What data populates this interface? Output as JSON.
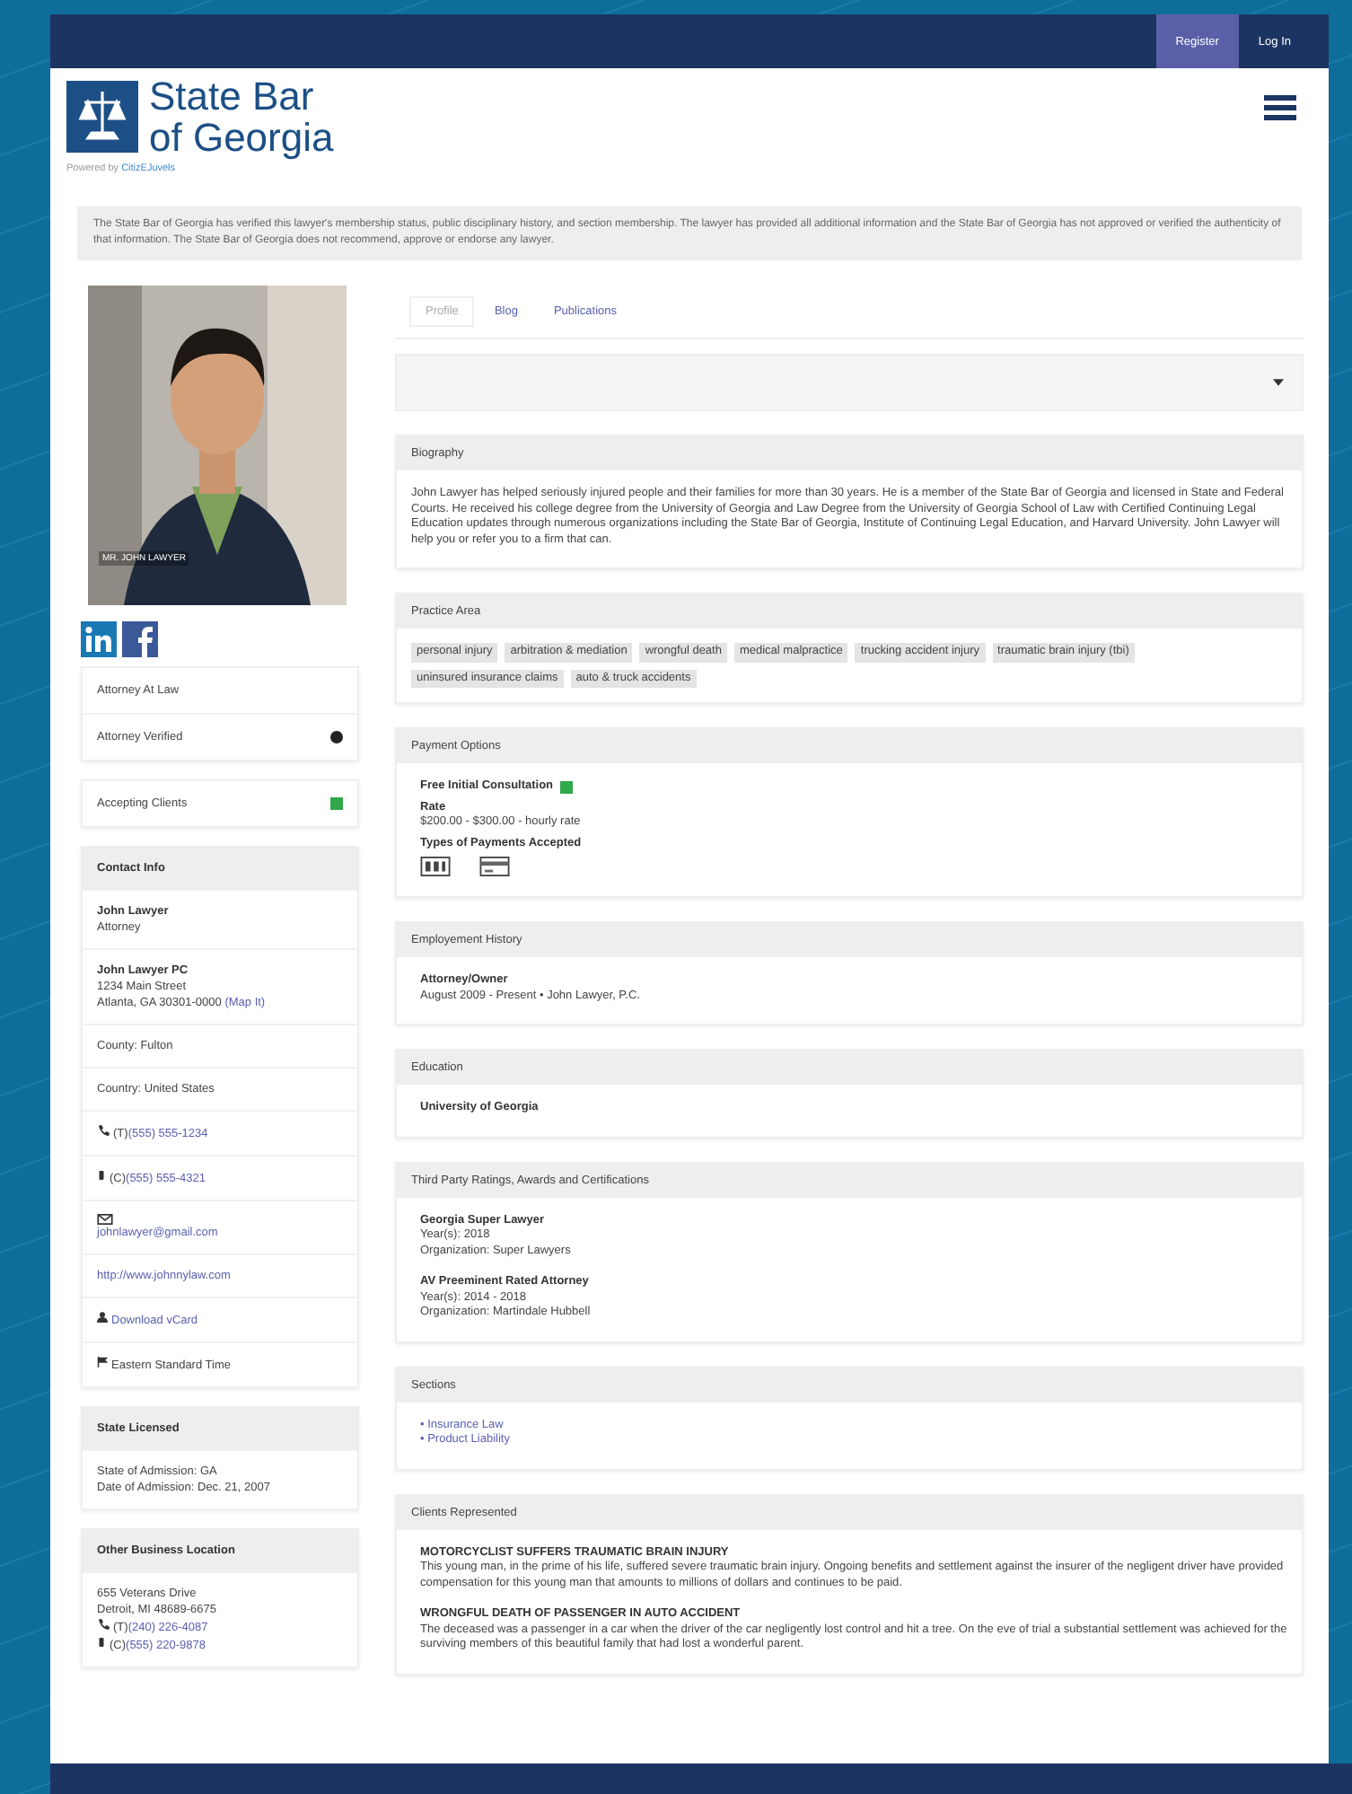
{
  "top_bar": {
    "buttons": [
      {
        "label": "Register",
        "selected": true
      },
      {
        "label": "Log In",
        "selected": false
      }
    ]
  },
  "logo": {
    "line1": "State Bar",
    "line2": "of Georgia",
    "powered_prefix": "Powered by",
    "powered_brand": "CitizEJuvels"
  },
  "notice": "The State Bar of Georgia has verified this lawyer's membership status, public disciplinary history, and section membership. The lawyer has provided all additional information and the State Bar of Georgia has not approved or verified the authenticity of that information. The State Bar of Georgia does not recommend, approve or endorse any lawyer.",
  "profile": {
    "photo_caption": "MR. JOHN LAWYER",
    "social": [
      {
        "kind": "linkedin"
      },
      {
        "kind": "facebook"
      }
    ]
  },
  "status_items": [
    {
      "label": "Attorney At Law",
      "kind": "plain"
    },
    {
      "label": "Attorney Verified",
      "kind": "verified"
    }
  ],
  "accepting_clients": {
    "label": "Accepting Clients",
    "checked": true
  },
  "contact_info": {
    "title": "Contact Info",
    "name": "John Lawyer",
    "role": "Attorney",
    "firm": "John Lawyer PC",
    "street": "1234 Main Street",
    "city": "Atlanta, GA 30301-0000",
    "map_link": "(Map It)",
    "rows": [
      {
        "kind": "text",
        "text": "County: Fulton"
      },
      {
        "kind": "text",
        "text": "Country: United States"
      },
      {
        "kind": "phone",
        "prefix": "(T)",
        "text": "(555) 555-1234"
      },
      {
        "kind": "mobile",
        "prefix": "(C)",
        "text": "(555) 555-4321"
      },
      {
        "kind": "email",
        "text": "johnlawyer@gmail.com"
      },
      {
        "kind": "link",
        "text": "http://www.johnnylaw.com"
      },
      {
        "kind": "vcard",
        "text": "Download vCard"
      },
      {
        "kind": "timezone",
        "text": "Eastern Standard Time"
      }
    ]
  },
  "state_licensed": {
    "title": "State Licensed",
    "lines": [
      "State of Admission: GA",
      "Date of Admission: Dec. 21, 2007"
    ]
  },
  "other_location": {
    "title": "Other Business Location",
    "lines": [
      "655 Veterans Drive",
      "Detroit, MI 48689-6675"
    ],
    "phones": [
      {
        "kind": "phone",
        "prefix": "(T)",
        "text": "(240) 226-4087"
      },
      {
        "kind": "mobile",
        "prefix": "(C)",
        "text": "(555) 220-9878"
      }
    ]
  },
  "tabs": [
    {
      "label": "Profile",
      "selected": true
    },
    {
      "label": "Blog",
      "selected": false
    },
    {
      "label": "Publications",
      "selected": false
    }
  ],
  "biography": {
    "title": "Biography",
    "text": "John Lawyer has helped seriously injured people and their families for more than 30 years. He is a member of the State Bar of Georgia and licensed in State and Federal Courts. He received his college degree from the University of Georgia and Law Degree from the University of Georgia School of Law with Certified Continuing Legal Education updates through numerous organizations including the State Bar of Georgia, Institute of Continuing Legal Education, and Harvard University. John Lawyer will help you or refer you to a firm that can."
  },
  "practice_area": {
    "title": "Practice Area",
    "tags": [
      "personal injury",
      "arbitration & mediation",
      "wrongful death",
      "medical malpractice",
      "trucking accident injury",
      "traumatic brain injury (tbi)",
      "uninsured insurance claims",
      "auto & truck accidents"
    ]
  },
  "payment_options": {
    "title": "Payment Options",
    "free_consultation": {
      "label": "Free Initial Consultation",
      "checked": true
    },
    "rate_label": "Rate",
    "rate": "$200.00 - $300.00 - hourly rate",
    "types_label": "Types of Payments Accepted",
    "types": [
      {
        "kind": "cash"
      },
      {
        "kind": "card"
      }
    ]
  },
  "employment": {
    "title": "Employement History",
    "entries": [
      {
        "role": "Attorney/Owner",
        "detail": "August 2009 - Present • John Lawyer, P.C."
      }
    ]
  },
  "education": {
    "title": "Education",
    "entries": [
      "University of Georgia"
    ]
  },
  "ratings": {
    "title": "Third Party Ratings, Awards and Certifications",
    "entries": [
      {
        "name": "Georgia Super Lawyer",
        "years": "Year(s): 2018",
        "org": "Organization: Super Lawyers"
      },
      {
        "name": "AV Preeminent Rated Attorney",
        "years": "Year(s): 2014 - 2018",
        "org": "Organization: Martindale Hubbell"
      }
    ]
  },
  "sections": {
    "title": "Sections",
    "links": [
      "• Insurance Law",
      "• Product Liability"
    ]
  },
  "clients": {
    "title": "Clients Represented",
    "cases": [
      {
        "title": "MOTORCYCLIST SUFFERS TRAUMATIC BRAIN INJURY",
        "text": "This young man, in the prime of his life, suffered severe traumatic brain injury. Ongoing benefits and settlement against the insurer of the negligent driver have provided compensation for this young man that amounts to millions of dollars and continues to be paid."
      },
      {
        "title": "WRONGFUL DEATH OF PASSENGER IN AUTO ACCIDENT",
        "text": "The deceased was a passenger in a car when the driver of the car negligently lost control and hit a tree. On the eve of trial a substantial settlement was achieved for the surviving members of this beautiful family that had lost a wonderful parent."
      }
    ]
  }
}
